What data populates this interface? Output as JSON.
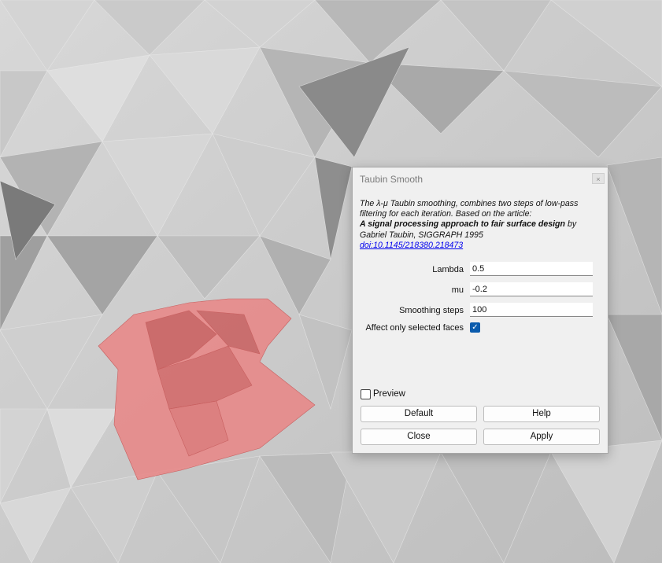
{
  "dialog": {
    "title": "Taubin Smooth",
    "close_glyph": "×",
    "description": {
      "line1_prefix": "The ",
      "symbol": "λ-μ",
      "line1_suffix": " Taubin smoothing, combines two steps of low-pass",
      "line2": "filtering for each iteration. Based on the article:",
      "article_title": "A signal processing approach to fair surface design",
      "by": " by",
      "author": "Gabriel Taubin, SIGGRAPH 1995",
      "doi": "doi:10.1145/218380.218473"
    },
    "params": {
      "lambda_label": "Lambda",
      "lambda_value": "0.5",
      "mu_label": "mu",
      "mu_value": "-0.2",
      "steps_label": "Smoothing steps",
      "steps_value": "100",
      "selected_label": "Affect only selected faces",
      "selected_checked": true
    },
    "preview_label": "Preview",
    "preview_checked": false,
    "buttons": {
      "default": "Default",
      "help": "Help",
      "close": "Close",
      "apply": "Apply"
    }
  },
  "viewport": {
    "mesh_color": "#cfcfcf",
    "selection_color": "#e98585",
    "checkbox_color": "#0b5cad"
  }
}
